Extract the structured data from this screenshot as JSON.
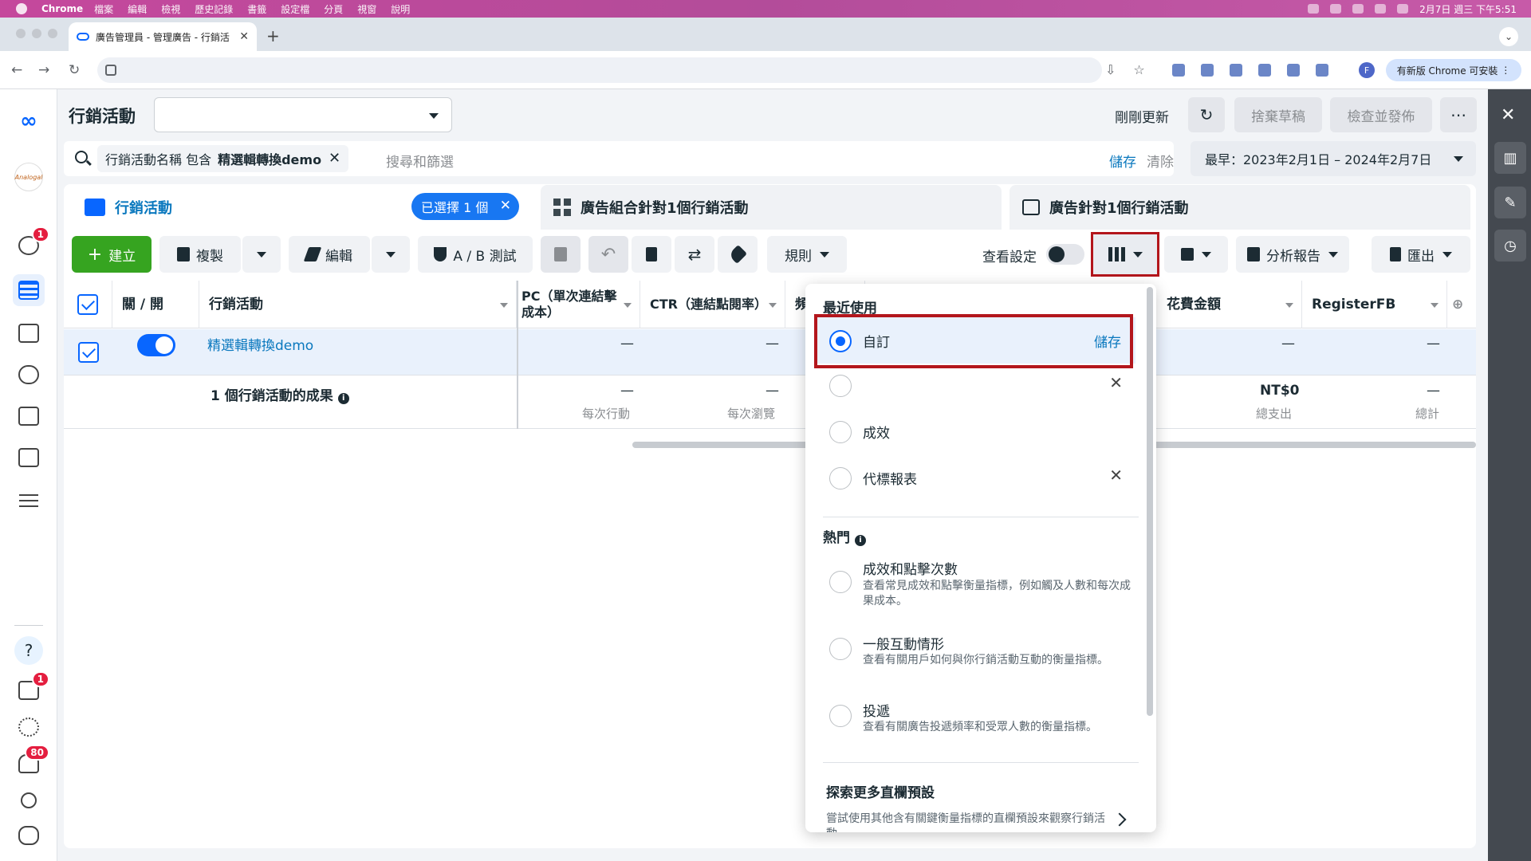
{
  "mac_menu": {
    "app": "Chrome",
    "items": [
      "檔案",
      "編輯",
      "檢視",
      "歷史記錄",
      "書籤",
      "設定檔",
      "分頁",
      "視窗",
      "說明"
    ],
    "clock": "2月7日 週三 下午5:51"
  },
  "browser": {
    "tab_title": "廣告管理員 - 管理廣告 - 行銷活",
    "update_label": "有新版 Chrome 可安裝",
    "profile_initial": "F"
  },
  "left_rail": {
    "avatar_text": "Analogal",
    "badges": {
      "alerts": "1",
      "notes": "1",
      "notifications": "80"
    },
    "help": "?"
  },
  "header": {
    "title": "行銷活動",
    "updated": "剛剛更新",
    "discard": "捨棄草稿",
    "review": "檢查並發佈",
    "more": "⋯"
  },
  "search": {
    "chip_prefix": "行銷活動名稱 包含",
    "chip_value": "精選輯轉換demo",
    "placeholder": "搜尋和篩選",
    "save": "儲存",
    "clear": "清除",
    "date_range": "最早：2023年2月1日 – 2024年2月7日"
  },
  "level_tabs": {
    "campaigns": "行銷活動",
    "selected_pill": "已選擇 1 個",
    "adsets": "廣告組合針對1個行銷活動",
    "ads": "廣告針對1個行銷活動"
  },
  "actions": {
    "create": "建立",
    "duplicate": "複製",
    "edit": "編輯",
    "ab_test": "A / B 測試",
    "rules": "規則",
    "view_settings": "查看設定",
    "reports": "分析報告",
    "export": "匯出"
  },
  "table": {
    "headers": {
      "toggle": "關 / 開",
      "campaign": "行銷活動",
      "cpc": "PC（單次連結擊成本）",
      "ctr": "CTR（連結點閱率）",
      "freq": "頻",
      "spend": "花費金額",
      "register": "RegisterFB"
    },
    "row": {
      "name": "精選輯轉換demo",
      "dash": "—"
    },
    "summary": {
      "label": "1 個行銷活動的成果",
      "cpc_sub": "每次行動",
      "ctr_sub": "每次瀏覽",
      "spend_value": "NT$0",
      "spend_sub": "總支出",
      "register_sub": "總計"
    }
  },
  "dropdown": {
    "recent_heading": "最近使用",
    "custom": "自訂",
    "custom_save": "儲存",
    "performance": "成效",
    "agency": "代標報表",
    "popular_heading": "熱門",
    "perf_clicks_title": "成效和點擊次數",
    "perf_clicks_desc": "查看常見成效和點擊衡量指標，例如觸及人數和每次成果成本。",
    "engagement_title": "一般互動情形",
    "engagement_desc": "查看有關用戶如何與你行銷活動互動的衡量指標。",
    "delivery_title": "投遞",
    "delivery_desc": "查看有關廣告投遞頻率和受眾人數的衡量指標。",
    "explore_heading": "探索更多直欄預設",
    "explore_desc": "嘗試使用其他含有關鍵衡量指標的直欄預設來觀察行銷活動"
  },
  "colors": {
    "accent": "#0866ff",
    "link": "#0a78be",
    "create_green": "#36a420",
    "highlight_box": "#b3161c"
  }
}
